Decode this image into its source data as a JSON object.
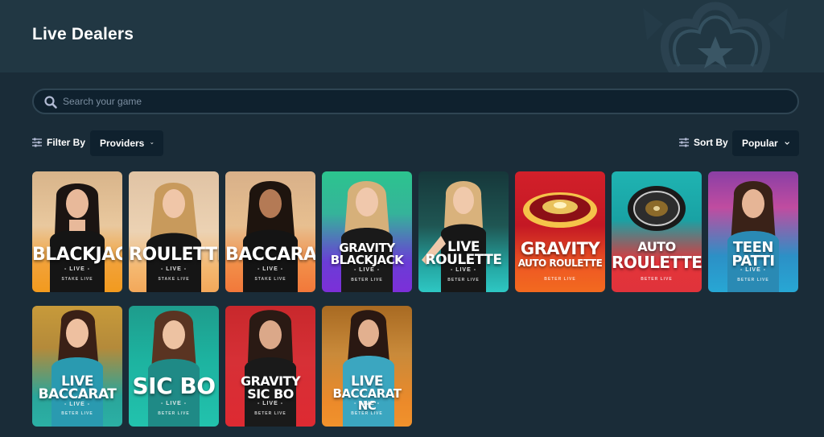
{
  "header": {
    "title": "Live Dealers"
  },
  "search": {
    "placeholder": "Search your game"
  },
  "filter": {
    "label": "Filter By",
    "providers_label": "Providers"
  },
  "sort": {
    "label": "Sort By",
    "selected": "Popular"
  },
  "colors": {
    "background": "#1a2c38",
    "header": "#213743",
    "input": "#0f212e",
    "border": "#2f4553"
  },
  "games": [
    {
      "title1": "BLACKJACK",
      "title2": "",
      "sub": "- LIVE -",
      "brand": "STAKE LIVE"
    },
    {
      "title1": "ROULETTE",
      "title2": "",
      "sub": "- LIVE -",
      "brand": "STAKE LIVE"
    },
    {
      "title1": "BACCARAT",
      "title2": "",
      "sub": "- LIVE -",
      "brand": "STAKE LIVE"
    },
    {
      "title1": "GRAVITY",
      "title2": "BLACKJACK",
      "sub": "- LIVE -",
      "brand": "BETER LIVE"
    },
    {
      "title1": "LIVE",
      "title2": "ROULETTE",
      "sub": "- LIVE -",
      "brand": "BETER LIVE"
    },
    {
      "title1": "GRAVITY",
      "title2": "AUTO ROULETTE",
      "sub": "",
      "brand": "BETER LIVE"
    },
    {
      "title1": "AUTO",
      "title2": "ROULETTE",
      "sub": "",
      "brand": "BETER LIVE"
    },
    {
      "title1": "TEEN",
      "title2": "PATTI",
      "sub": "- LIVE -",
      "brand": "BETER LIVE"
    },
    {
      "title1": "LIVE",
      "title2": "BACCARAT",
      "sub": "- LIVE -",
      "brand": "BETER LIVE"
    },
    {
      "title1": "SIC BO",
      "title2": "",
      "sub": "- LIVE -",
      "brand": "BETER LIVE"
    },
    {
      "title1": "GRAVITY",
      "title2": "SIC BO",
      "sub": "- LIVE -",
      "brand": "BETER LIVE"
    },
    {
      "title1": "LIVE",
      "title2": "BACCARAT NC",
      "sub": "- LIVE -",
      "brand": "BETER LIVE"
    }
  ]
}
